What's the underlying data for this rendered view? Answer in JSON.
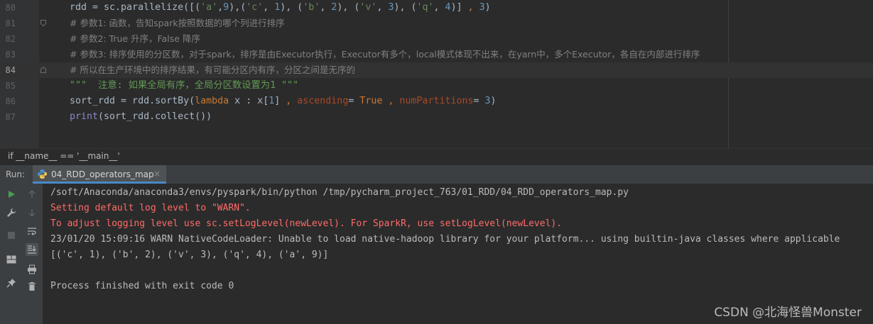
{
  "editor": {
    "lines": [
      {
        "num": "80"
      },
      {
        "num": "81",
        "comment": "# 参数1: 函数，告知spark按照数据的哪个列进行排序"
      },
      {
        "num": "82",
        "comment": "# 参数2: True 升序，False 降序"
      },
      {
        "num": "83",
        "comment": "# 参数3: 排序使用的分区数，对于spark，排序是由Executor执行，Executor有多个，local模式体现不出来，在yarn中，多个Executor，各自在内部进行排序"
      },
      {
        "num": "84",
        "comment": "# 所以在生产环境中的排序结果，有可能分区内有序，分区之间是无序的"
      },
      {
        "num": "85",
        "docstring": "\"\"\"  注意: 如果全局有序，全局分区数设置为1 \"\"\""
      },
      {
        "num": "86"
      },
      {
        "num": "87"
      }
    ],
    "line80": {
      "a": "rdd = sc.parallelize([(",
      "s1": "'a'",
      "c1": ",",
      "n1": "9",
      "c2": "),(",
      "s2": "'c'",
      "c3": ", ",
      "n2": "1",
      "c4": "), (",
      "s3": "'b'",
      "c5": ", ",
      "n3": "2",
      "c6": "), (",
      "s4": "'v'",
      "c7": ", ",
      "n4": "3",
      "c8": "), (",
      "s5": "'q'",
      "c9": ", ",
      "n5": "4",
      "c10": ")] ",
      "k1": ",",
      "c11": " ",
      "n6": "3",
      "c12": ")"
    },
    "line86": {
      "a": "sort_rdd = rdd.sortBy(",
      "kw_lambda": "lambda",
      "b": " x : x[",
      "n1": "1",
      "c1": "] ",
      "k1": ",",
      "p1": " ascending",
      "c2": "= ",
      "kw_true": "True",
      "c3": " ",
      "k2": ",",
      "p2": " numPartitions",
      "c4": "= ",
      "n2": "3",
      "c5": ")"
    },
    "line87": {
      "fn": "print",
      "a": "(sort_rdd.collect())"
    }
  },
  "breadcrumb": "if __name__ == '__main__'",
  "run": {
    "label": "Run:",
    "tab_title": "04_RDD_operators_map",
    "tab_close": "×"
  },
  "console": {
    "lines": [
      {
        "text": "/soft/Anaconda/anaconda3/envs/pyspark/bin/python /tmp/pycharm_project_763/01_RDD/04_RDD_operators_map.py",
        "type": "normal"
      },
      {
        "text": "Setting default log level to \"WARN\".",
        "type": "err"
      },
      {
        "text": "To adjust logging level use sc.setLogLevel(newLevel). For SparkR, use setLogLevel(newLevel).",
        "type": "err"
      },
      {
        "text": "23/01/20 15:09:16 WARN NativeCodeLoader: Unable to load native-hadoop library for your platform... using builtin-java classes where applicable",
        "type": "normal"
      },
      {
        "text": "[('c', 1), ('b', 2), ('v', 3), ('q', 4), ('a', 9)]",
        "type": "normal"
      },
      {
        "text": "",
        "type": "normal"
      },
      {
        "text": "Process finished with exit code 0",
        "type": "normal"
      }
    ]
  },
  "watermark": "CSDN @北海怪兽Monster",
  "icons": {
    "toolbar_left": [
      "rerun-icon",
      "wrench-icon",
      "stop-icon",
      "layout-icon",
      "pin-icon"
    ],
    "toolbar_right": [
      "arrow-up-icon",
      "arrow-down-icon",
      "soft-wrap-icon",
      "scroll-to-end-icon",
      "print-icon",
      "trash-icon"
    ]
  },
  "colors": {
    "background": "#2b2b2b",
    "error_text": "#ff6b68",
    "run_green": "#499c54",
    "tab_underline": "#4a88c7"
  }
}
